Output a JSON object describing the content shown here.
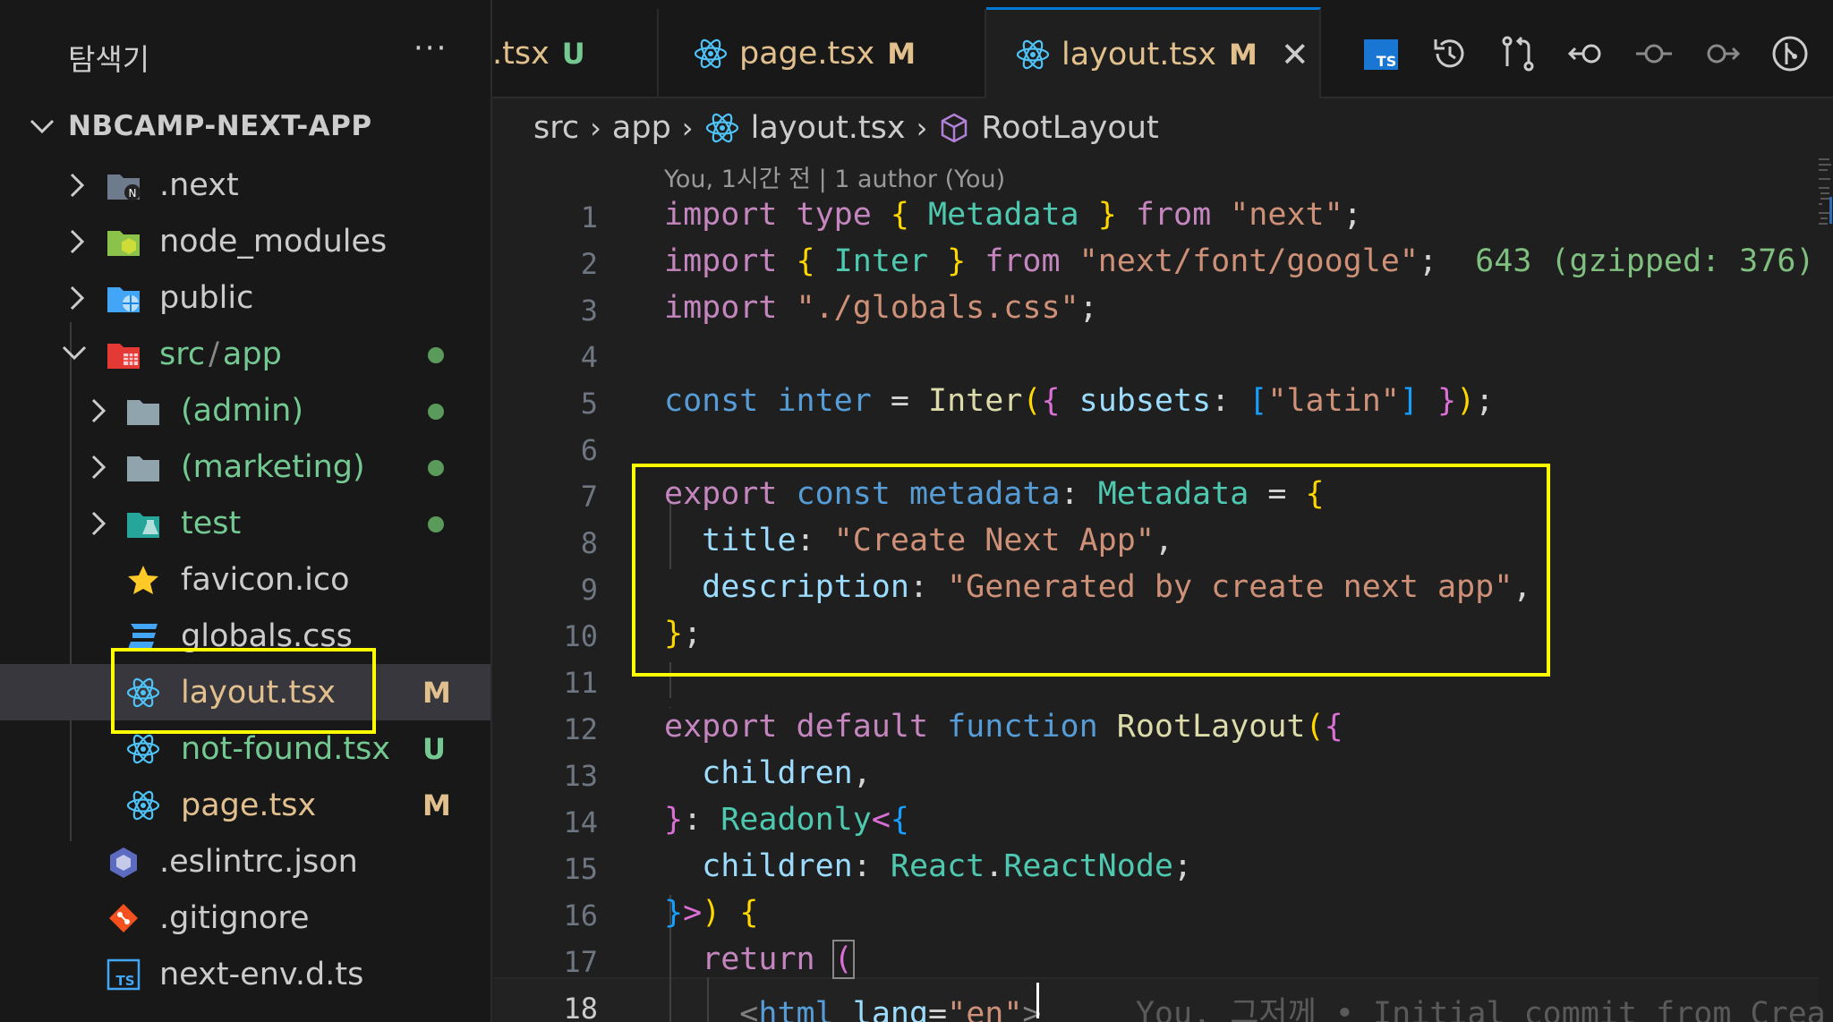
{
  "sidebar": {
    "title": "탐색기",
    "more": "···",
    "project": "NBCAMP-NEXT-APP",
    "items": [
      {
        "label": ".next",
        "icon": "next-folder-icon"
      },
      {
        "label": "node_modules",
        "icon": "node-folder-icon"
      },
      {
        "label": "public",
        "icon": "public-folder-icon"
      },
      {
        "label_a": "src",
        "label_sep": "/",
        "label_b": "app",
        "icon": "src-folder-icon"
      },
      {
        "label": "(admin)",
        "icon": "folder-icon"
      },
      {
        "label": "(marketing)",
        "icon": "folder-icon"
      },
      {
        "label": "test",
        "icon": "test-folder-icon"
      },
      {
        "label": "favicon.ico",
        "icon": "star-icon"
      },
      {
        "label": "globals.css",
        "icon": "css-icon"
      },
      {
        "label": "layout.tsx",
        "icon": "react-icon",
        "badge": "M"
      },
      {
        "label": "not-found.tsx",
        "icon": "react-icon",
        "badge": "U"
      },
      {
        "label": "page.tsx",
        "icon": "react-icon",
        "badge": "M"
      },
      {
        "label": ".eslintrc.json",
        "icon": "eslint-icon"
      },
      {
        "label": ".gitignore",
        "icon": "git-icon"
      },
      {
        "label": "next-env.d.ts",
        "icon": "ts-icon"
      }
    ]
  },
  "tabs": [
    {
      "label": ".tsx",
      "mod": "U"
    },
    {
      "label": "page.tsx",
      "mod": "M"
    },
    {
      "label": "layout.tsx",
      "mod": "M",
      "close": "✕"
    }
  ],
  "breadcrumb": {
    "parts": [
      "src",
      "app",
      "layout.tsx",
      "RootLayout"
    ],
    "sep": "›"
  },
  "editor": {
    "codelens": "You, 1시간 전 | 1 author (You)",
    "line_numbers": [
      "1",
      "2",
      "3",
      "4",
      "5",
      "6",
      "7",
      "8",
      "9",
      "10",
      "11",
      "12",
      "13",
      "14",
      "15",
      "16",
      "17",
      "18"
    ],
    "l1": {
      "import": "import",
      "type": "type",
      "ob": "{",
      "name": "Metadata",
      "cb": "}",
      "from": "from",
      "str": "\"next\"",
      "semi": ";"
    },
    "l2": {
      "import": "import",
      "ob": "{",
      "name": "Inter",
      "cb": "}",
      "from": "from",
      "str": "\"next/font/google\"",
      "semi": ";",
      "hint": "643 (gzipped: 376)"
    },
    "l3": {
      "import": "import",
      "str": "\"./globals.css\"",
      "semi": ";"
    },
    "l5": {
      "const": "const",
      "name": "inter",
      "eq": "=",
      "fn": "Inter",
      "op": "(",
      "ob": "{",
      "key": "subsets",
      "colon": ":",
      "arr_o": "[",
      "str": "\"latin\"",
      "arr_c": "]",
      "cb": "}",
      "cp": ")",
      "semi": ";"
    },
    "l7": {
      "export": "export",
      "const": "const",
      "name": "metadata",
      "colon": ":",
      "type": "Metadata",
      "eq": "=",
      "ob": "{"
    },
    "l8": {
      "key": "title",
      "colon": ":",
      "str": "\"Create Next App\"",
      "comma": ","
    },
    "l9": {
      "key": "description",
      "colon": ":",
      "str": "\"Generated by create next app\"",
      "comma": ","
    },
    "l10": {
      "cb": "}",
      "semi": ";"
    },
    "l12": {
      "export": "export",
      "default": "default",
      "function": "function",
      "name": "RootLayout",
      "op": "(",
      "ob": "{"
    },
    "l13": {
      "name": "children",
      "comma": ","
    },
    "l14": {
      "cb": "}",
      "colon": ":",
      "type": "Readonly",
      "lt": "<",
      "ob": "{"
    },
    "l15": {
      "name": "children",
      "colon": ":",
      "ns": "React",
      "dot": ".",
      "type": "ReactNode",
      "semi": ";"
    },
    "l16": {
      "cb": "}",
      "gt": ">",
      "cp": ")",
      "ob": "{"
    },
    "l17": {
      "ret": "return",
      "op": "("
    },
    "l18": {
      "tag_o": "<",
      "tag": "html",
      "attr": "lang",
      "eq": "=",
      "val": "\"en\"",
      "tag_c": ">",
      "blame": "You, 그저께 • Initial commit from Crea"
    }
  }
}
